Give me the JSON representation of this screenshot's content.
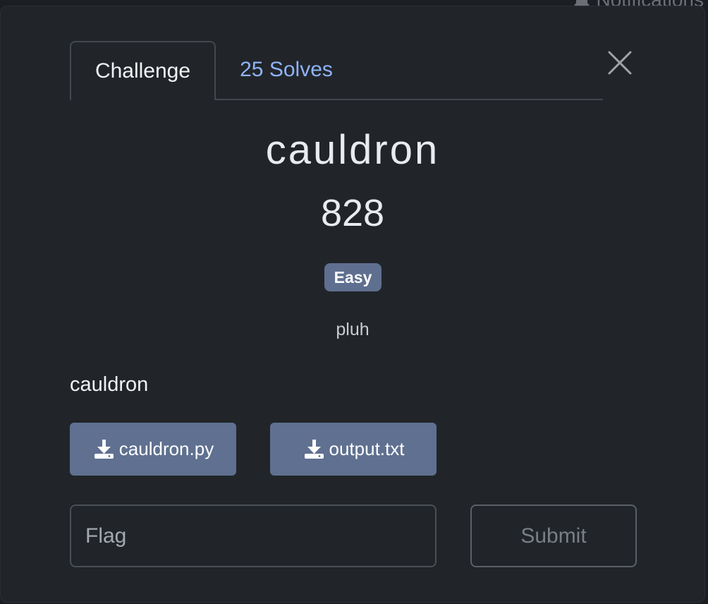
{
  "background": {
    "notifications_label": "Notifications"
  },
  "tabs": [
    {
      "label": "Challenge",
      "active": true
    },
    {
      "label": "25 Solves",
      "active": false
    }
  ],
  "challenge": {
    "name": "cauldron",
    "points": "828",
    "difficulty": "Easy",
    "author": "pluh",
    "description": "cauldron"
  },
  "files": [
    {
      "name": "cauldron.py",
      "icon": "download-icon"
    },
    {
      "name": "output.txt",
      "icon": "download-icon"
    }
  ],
  "flag_input": {
    "placeholder": "Flag",
    "value": ""
  },
  "submit": {
    "label": "Submit"
  },
  "colors": {
    "accent": "#8fb3f7",
    "badge": "#5f6f8f",
    "file_button": "#5f7090",
    "background": "#212529"
  }
}
